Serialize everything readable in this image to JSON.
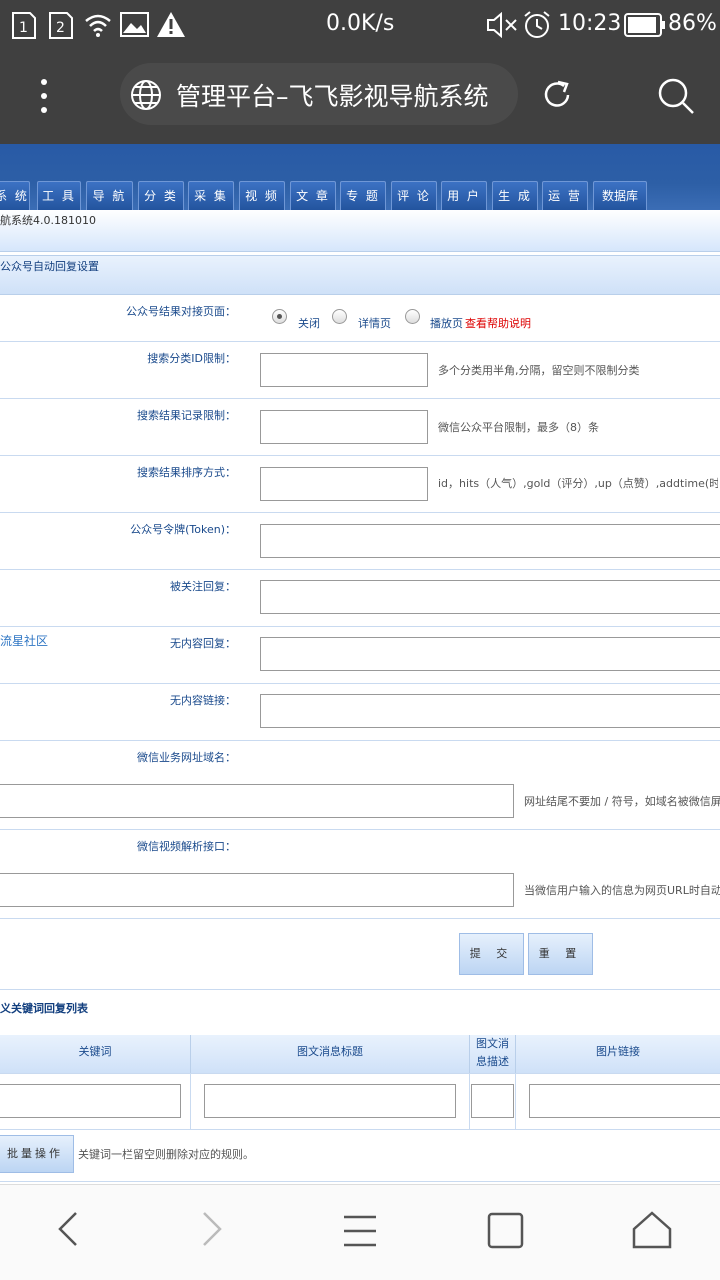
{
  "status": {
    "sim1": "1",
    "sim2": "2",
    "speed": "0.0K/s",
    "time": "10:23",
    "battery": "86%"
  },
  "browser": {
    "title": "管理平台–飞飞影视导航系统"
  },
  "header": {
    "tabs": [
      "系 统",
      "工 具",
      "导 航",
      "分 类",
      "采 集",
      "视 频",
      "文 章",
      "专 题",
      "评 论",
      "用 户",
      "生 成",
      "运 营",
      "数据库"
    ]
  },
  "version": "航系统4.0.181010",
  "section_title": "公众号自动回复设置",
  "form": {
    "result_label": "公众号结果对接页面：",
    "radio_close": "关闭",
    "radio_detail": "详情页",
    "radio_play": "播放页",
    "help_link": "查看帮助说明",
    "cid_label": "搜索分类ID限制：",
    "cid_hint": "多个分类用半角,分隔，留空则不限制分类",
    "limit_label": "搜索结果记录限制：",
    "limit_hint": "微信公众平台限制，最多（8）条",
    "order_label": "搜索结果排序方式：",
    "order_hint": "id，hits（人气）,gold（评分）,up（点赞）,addtime(时间)",
    "token_label": "公众号令牌(Token)：",
    "follow_label": "被关注回复：",
    "side_link": "流星社区",
    "nocontent_label": "无内容回复：",
    "nolink_label": "无内容链接：",
    "domain_label": "微信业务网址域名：",
    "domain_hint": "网址结尾不要加 / 符号，如域名被微信屏蔽",
    "video_label": "微信视频解析接口：",
    "video_hint": "当微信用户输入的信息为网页URL时自动地",
    "submit": "提 交",
    "reset": "重 置"
  },
  "keyword": {
    "title": "义关键词回复列表",
    "col_keyword": "关键词",
    "col_title": "图文消息标题",
    "col_desc_1": "图文消",
    "col_desc_2": "息描述",
    "col_pic": "图片链接",
    "batch": "批量操作",
    "batch_hint": "关键词一栏留空则删除对应的规则。"
  }
}
